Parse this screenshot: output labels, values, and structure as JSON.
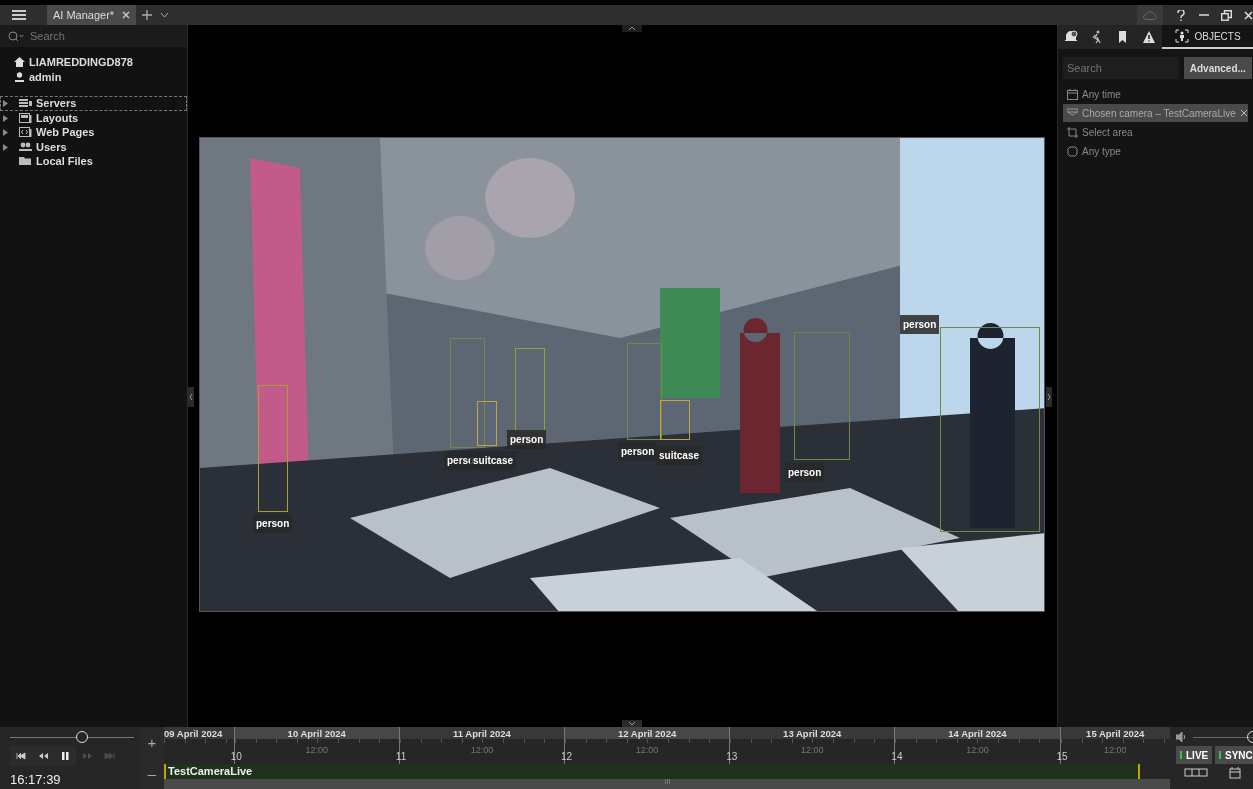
{
  "title_bar": {
    "tabs": [
      {
        "label": "AI Manager*",
        "selected": true
      }
    ]
  },
  "sidebar": {
    "search": {
      "placeholder": "Search"
    },
    "site": "LIAMREDDINGD878",
    "user": "admin",
    "items": [
      {
        "label": "Servers",
        "kind": "servers",
        "expandable": true,
        "selected": true
      },
      {
        "label": "Layouts",
        "kind": "layouts",
        "expandable": true,
        "selected": false
      },
      {
        "label": "Web Pages",
        "kind": "web",
        "expandable": true,
        "selected": false
      },
      {
        "label": "Users",
        "kind": "users",
        "expandable": true,
        "selected": false
      },
      {
        "label": "Local Files",
        "kind": "folder",
        "expandable": false,
        "selected": false
      }
    ]
  },
  "video": {
    "detections": [
      {
        "label": "person",
        "color": "#a8a030"
      },
      {
        "label": "perso",
        "color": "#6f8a45"
      },
      {
        "label": "suitcase",
        "color": "#c8a040"
      },
      {
        "label": "person",
        "color": "#9aa030"
      },
      {
        "label": "person",
        "color": "#6f8a45"
      },
      {
        "label": "suitcase",
        "color": "#c8a040"
      },
      {
        "label": "person",
        "color": "#6f8a45"
      },
      {
        "label": "person",
        "color": "#6f8a45"
      }
    ]
  },
  "right_panel": {
    "tabs": [
      {
        "kind": "notifications",
        "selected": false
      },
      {
        "kind": "motion",
        "selected": false
      },
      {
        "kind": "bookmarks",
        "selected": false
      },
      {
        "kind": "events",
        "selected": false
      },
      {
        "kind": "objects",
        "label": "OBJECTS",
        "selected": true
      }
    ],
    "search": {
      "placeholder": "Search"
    },
    "advanced_button": "Advanced...",
    "filters": [
      {
        "kind": "time",
        "label": "Any time",
        "active": false
      },
      {
        "kind": "camera",
        "label": "Chosen camera – TestCameraLive",
        "active": true
      },
      {
        "kind": "area",
        "label": "Select area",
        "active": false
      },
      {
        "kind": "type",
        "label": "Any type",
        "active": false
      }
    ]
  },
  "timeline": {
    "speed": {
      "level": 0.58
    },
    "controls": [
      {
        "kind": "start",
        "disabled": false
      },
      {
        "kind": "back",
        "disabled": false
      },
      {
        "kind": "pause",
        "disabled": false
      },
      {
        "kind": "forward",
        "disabled": true
      },
      {
        "kind": "end",
        "disabled": true
      }
    ],
    "time": "16:17:39",
    "zoom_in": "+",
    "zoom_out": "–",
    "days": [
      {
        "date": "09 April 2024"
      },
      {
        "date": "10 April 2024",
        "hour": "10",
        "midday": "12:00"
      },
      {
        "date": "11 April 2024",
        "hour": "11",
        "midday": "12:00"
      },
      {
        "date": "12 April 2024",
        "hour": "12",
        "midday": "12:00"
      },
      {
        "date": "13 April 2024",
        "hour": "13",
        "midday": "12:00"
      },
      {
        "date": "14 April 2024",
        "hour": "14",
        "midday": "12:00"
      },
      {
        "date": "15 April 2024",
        "hour": "15",
        "midday": "12:00"
      }
    ],
    "camera": "TestCameraLive",
    "volume": {
      "level": 1.0
    },
    "live": {
      "label": "LIVE",
      "on": true
    },
    "sync": {
      "label": "SYNC",
      "on": true
    }
  }
}
